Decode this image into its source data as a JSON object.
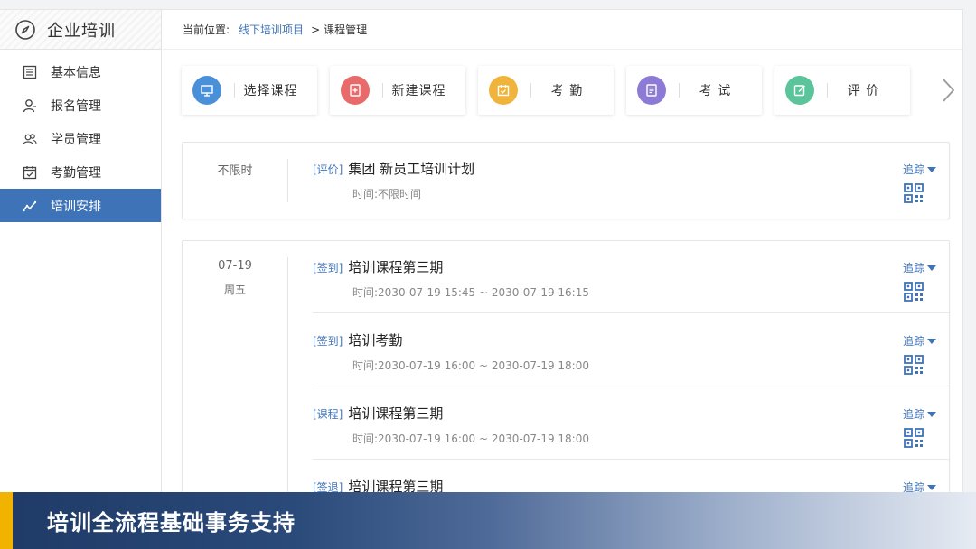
{
  "brand": {
    "title": "企业培训",
    "icon": "compass-icon"
  },
  "sidebar": {
    "items": [
      {
        "label": "基本信息",
        "icon": "list-icon",
        "active": false
      },
      {
        "label": "报名管理",
        "icon": "user-add-icon",
        "active": false
      },
      {
        "label": "学员管理",
        "icon": "users-icon",
        "active": false
      },
      {
        "label": "考勤管理",
        "icon": "calendar-check-icon",
        "active": false
      },
      {
        "label": "培训安排",
        "icon": "trend-icon",
        "active": true
      }
    ]
  },
  "breadcrumb": {
    "prefix": "当前位置:",
    "link": "线下培训项目",
    "separator": ">",
    "current": "课程管理"
  },
  "actions": [
    {
      "label": "选择课程",
      "icon": "monitor-icon",
      "color": "#4a90d9"
    },
    {
      "label": "新建课程",
      "icon": "new-doc-icon",
      "color": "#e86a6a"
    },
    {
      "label": "考 勤",
      "icon": "calendar-icon",
      "color": "#f0b43c"
    },
    {
      "label": "考 试",
      "icon": "document-icon",
      "color": "#8c7ad6"
    },
    {
      "label": "评 价",
      "icon": "edit-icon",
      "color": "#5cc49a"
    }
  ],
  "card1": {
    "date": "不限时",
    "event": {
      "tag": "[评价]",
      "name": "集团  新员工培训计划",
      "time": "时间:不限时间",
      "track": "追踪"
    }
  },
  "card2": {
    "date": "07-19",
    "weekday": "周五",
    "events": [
      {
        "tag": "[签到]",
        "name": "培训课程第三期",
        "time": "时间:2030-07-19 15:45 ~ 2030-07-19 16:15",
        "track": "追踪"
      },
      {
        "tag": "[签到]",
        "name": "培训考勤",
        "time": "时间:2030-07-19 16:00 ~ 2030-07-19 18:00",
        "track": "追踪"
      },
      {
        "tag": "[课程]",
        "name": "培训课程第三期",
        "time": "时间:2030-07-19 16:00 ~ 2030-07-19 18:00",
        "track": "追踪"
      },
      {
        "tag": "[签退]",
        "name": "培训课程第三期",
        "time": "",
        "track": "追踪"
      }
    ]
  },
  "banner": {
    "text": "培训全流程基础事务支持"
  },
  "colors": {
    "accent": "#3f73b8",
    "highlight": "#f1b300"
  }
}
